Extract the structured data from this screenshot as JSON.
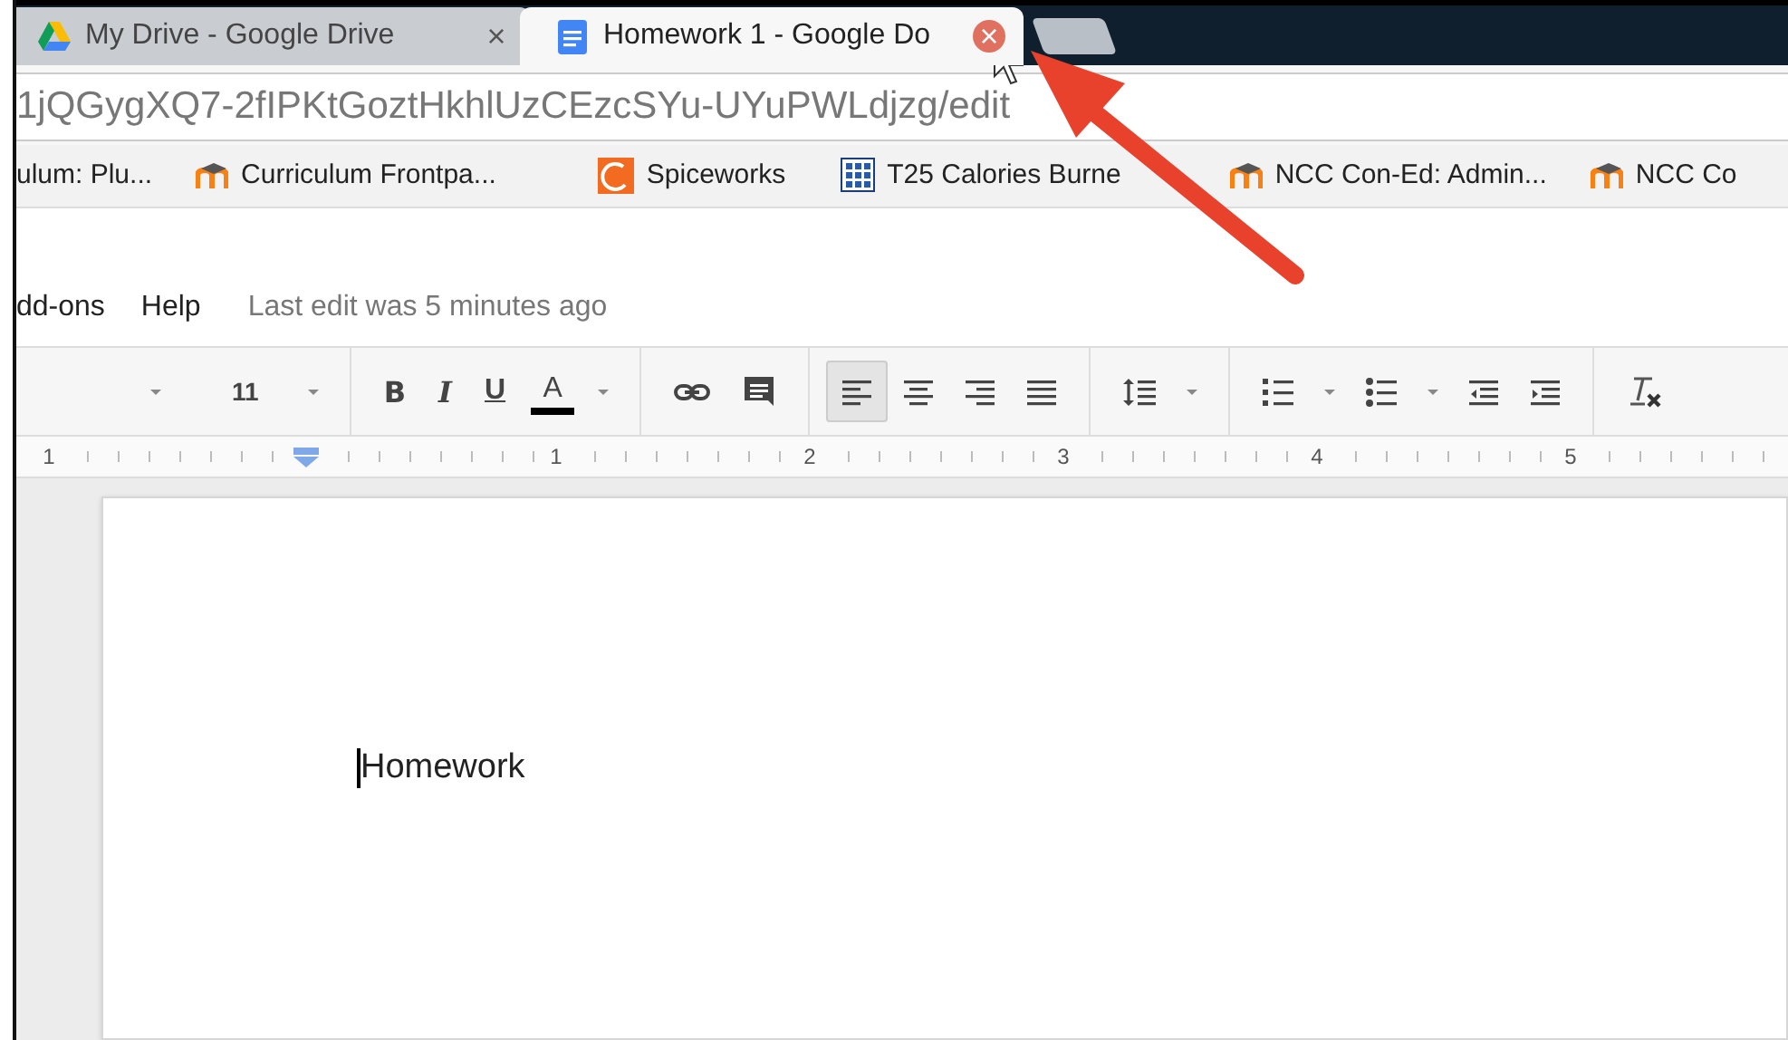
{
  "browser": {
    "tabs": [
      {
        "title": "My Drive - Google Drive",
        "close": "×",
        "kind": "drive",
        "selected": false
      },
      {
        "title": "Homework 1 - Google Do",
        "close": "×",
        "kind": "docs",
        "selected": true
      }
    ],
    "address": "1jQGygXQ7-2fIPKtGoztHkhlUzCEzcSYu-UYuPWLdjzg/edit",
    "bookmarks": [
      {
        "label": "ulum: Plu...",
        "kind": "none"
      },
      {
        "label": "Curriculum Frontpa...",
        "kind": "moodle"
      },
      {
        "label": "Spiceworks",
        "kind": "spiceworks"
      },
      {
        "label": "T25 Calories Burne",
        "kind": "grid"
      },
      {
        "label": "NCC Con-Ed: Admin...",
        "kind": "moodle"
      },
      {
        "label": "NCC Co",
        "kind": "moodle"
      }
    ]
  },
  "menu": {
    "items": [
      "dd-ons",
      "Help"
    ],
    "status": "Last edit was 5 minutes ago"
  },
  "toolbar": [
    {
      "kind": "caret"
    },
    {
      "kind": "font-size",
      "label": "11"
    },
    {
      "kind": "caret"
    },
    {
      "kind": "sep"
    },
    {
      "kind": "bold",
      "label": "B"
    },
    {
      "kind": "italic",
      "label": "I"
    },
    {
      "kind": "underline",
      "label": "U"
    },
    {
      "kind": "text-color",
      "label": "A",
      "color": "#000000"
    },
    {
      "kind": "caret"
    },
    {
      "kind": "sep"
    },
    {
      "kind": "link"
    },
    {
      "kind": "comment"
    },
    {
      "kind": "sep"
    },
    {
      "kind": "align-left",
      "selected": true
    },
    {
      "kind": "align-center",
      "selected": false
    },
    {
      "kind": "align-right",
      "selected": false
    },
    {
      "kind": "justify",
      "selected": false
    },
    {
      "kind": "sep"
    },
    {
      "kind": "line-spacing"
    },
    {
      "kind": "caret"
    },
    {
      "kind": "sep"
    },
    {
      "kind": "numbered-list"
    },
    {
      "kind": "caret"
    },
    {
      "kind": "bulleted-list"
    },
    {
      "kind": "caret"
    },
    {
      "kind": "indent-less"
    },
    {
      "kind": "indent-more"
    },
    {
      "kind": "sep"
    },
    {
      "kind": "clear-format"
    }
  ],
  "ruler": [
    {
      "kind": "number",
      "label": "1"
    },
    {
      "kind": "indent-marker"
    },
    {
      "kind": "number",
      "label": "1"
    },
    {
      "kind": "number",
      "label": "2"
    },
    {
      "kind": "number",
      "label": "3"
    },
    {
      "kind": "number",
      "label": "4"
    },
    {
      "kind": "number",
      "label": "5"
    }
  ],
  "document": {
    "text": "Homework"
  }
}
